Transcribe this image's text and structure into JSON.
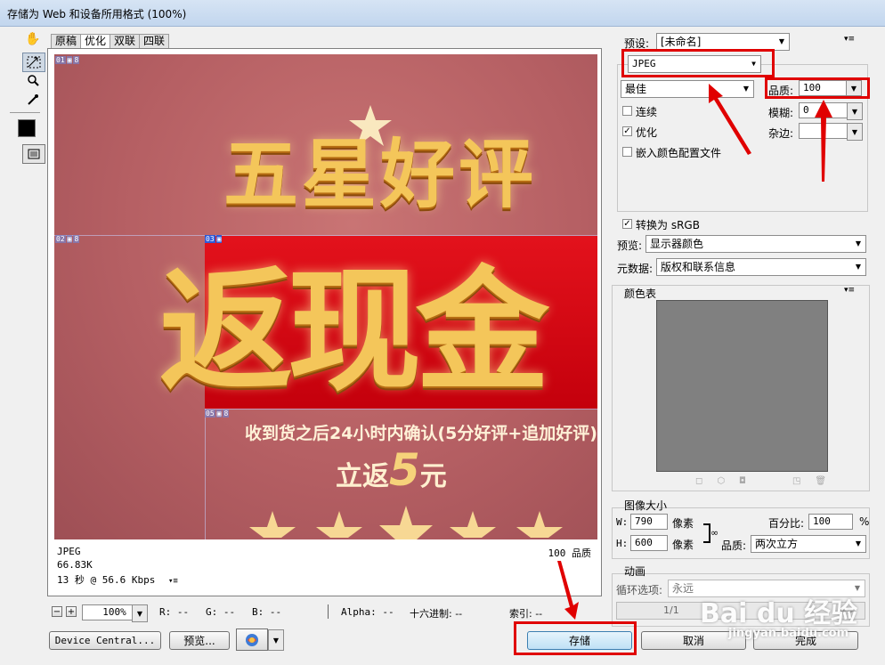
{
  "window": {
    "title": "存储为 Web 和设备所用格式 (100%)"
  },
  "tools": [
    "hand-icon",
    "slice-select-icon",
    "zoom-icon",
    "eyedropper-icon",
    "color-swatch",
    "toggle-slices-icon"
  ],
  "tabs": [
    "原稿",
    "优化",
    "双联",
    "四联"
  ],
  "canvas": {
    "slices": [
      "01",
      "02",
      "03",
      "05"
    ],
    "headline": "五星好评",
    "banner_text": "返现金",
    "subline": "收到货之后24小时内确认(5分好评+追加好评)",
    "refund_prefix": "立返",
    "refund_amount": "5",
    "refund_unit": "元"
  },
  "info": {
    "format": "JPEG",
    "size": "66.83K",
    "time": "13 秒 @ 56.6 Kbps",
    "quality_value": "100",
    "quality_label": "品质"
  },
  "statusbar": {
    "zoom": "100%",
    "r": "R: --",
    "g": "G: --",
    "b": "B: --",
    "alpha": "Alpha: --",
    "hex": "十六进制: --",
    "index": "索引: --"
  },
  "buttons": {
    "device_central": "Device Central...",
    "preview": "预览...",
    "save": "存储",
    "cancel": "取消",
    "done": "完成"
  },
  "settings": {
    "preset_label": "预设:",
    "preset_value": "[未命名]",
    "format": "JPEG",
    "quality_preset": "最佳",
    "quality_label": "品质:",
    "quality_value": "100",
    "progressive": "连续",
    "blur_label": "模糊:",
    "blur_value": "0",
    "optimized": "优化",
    "matte_label": "杂边:",
    "embed_profile": "嵌入颜色配置文件",
    "convert_srgb": "转换为 sRGB",
    "preview_label": "预览:",
    "preview_value": "显示器颜色",
    "metadata_label": "元数据:",
    "metadata_value": "版权和联系信息"
  },
  "color_table": {
    "title": "颜色表"
  },
  "image_size": {
    "title": "图像大小",
    "w_label": "W:",
    "w_value": "790",
    "w_unit": "像素",
    "h_label": "H:",
    "h_value": "600",
    "h_unit": "像素",
    "percent_label": "百分比:",
    "percent_value": "100",
    "percent_unit": "%",
    "quality_label": "品质:",
    "quality_value": "两次立方"
  },
  "animation": {
    "title": "动画",
    "loop_label": "循环选项:",
    "loop_value": "永远",
    "frame": "1/1"
  },
  "watermark": {
    "brand": "Bai du 经验",
    "url": "jingyan.baidu.com"
  }
}
